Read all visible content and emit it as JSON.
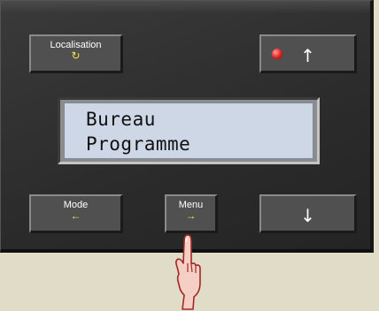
{
  "buttons": {
    "localisation": {
      "label": "Localisation",
      "symbol": "↻"
    },
    "up": {
      "symbol": "↑",
      "led": "red"
    },
    "mode": {
      "label": "Mode",
      "symbol": "←"
    },
    "menu": {
      "label": "Menu",
      "symbol": "→"
    },
    "down": {
      "symbol": "↓"
    }
  },
  "display": {
    "line1": "Bureau",
    "line2": "Programme"
  },
  "colors": {
    "background": "#e1dcc7",
    "panel": "#2b2b2b",
    "button": "#505050",
    "lcd": "#cdd7e6",
    "symbol_accent": "#f2e34a",
    "led": "#e22020"
  }
}
